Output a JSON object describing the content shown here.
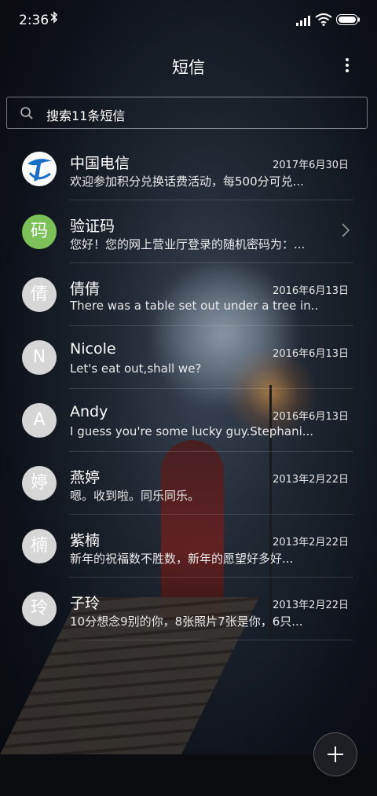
{
  "status_bar": {
    "time": "2:36"
  },
  "header": {
    "title": "短信"
  },
  "search": {
    "placeholder": "搜索11条短信"
  },
  "messages": [
    {
      "avatar": "",
      "name": "中国电信",
      "date": "2017年6月30日",
      "preview": "欢迎参加积分兑换话费活动，每500分可兑..."
    },
    {
      "avatar": "码",
      "name": "验证码",
      "date": "",
      "preview": "您好！您的网上营业厅登录的随机密码为：..."
    },
    {
      "avatar": "倩",
      "name": "倩倩",
      "date": "2016年6月13日",
      "preview": "There was a table set out under a tree in..."
    },
    {
      "avatar": "N",
      "name": "Nicole",
      "date": "2016年6月13日",
      "preview": "Let's eat out,shall we?"
    },
    {
      "avatar": "A",
      "name": "Andy",
      "date": "2016年6月13日",
      "preview": "I guess you're some lucky guy.Stephani..."
    },
    {
      "avatar": "婷",
      "name": "燕婷",
      "date": "2013年2月22日",
      "preview": "嗯。收到啦。同乐同乐。"
    },
    {
      "avatar": "楠",
      "name": "紫楠",
      "date": "2013年2月22日",
      "preview": "新年的祝福数不胜数，新年的愿望好多好..."
    },
    {
      "avatar": "玲",
      "name": "子玲",
      "date": "2013年2月22日",
      "preview": "10分想念9别的你，8张照片7张是你，6只..."
    }
  ],
  "icons": {
    "bluetooth": "bluetooth-icon",
    "signal": "signal-icon",
    "wifi": "wifi-icon",
    "battery": "battery-icon",
    "more": "more-vertical-icon",
    "search": "search-icon",
    "chevron": "chevron-right-icon",
    "compose": "plus-icon"
  },
  "colors": {
    "verify_avatar": "#7cc05a",
    "contact_avatar": "#d6d6d6",
    "telecom_logo": "#1a6fc4"
  }
}
